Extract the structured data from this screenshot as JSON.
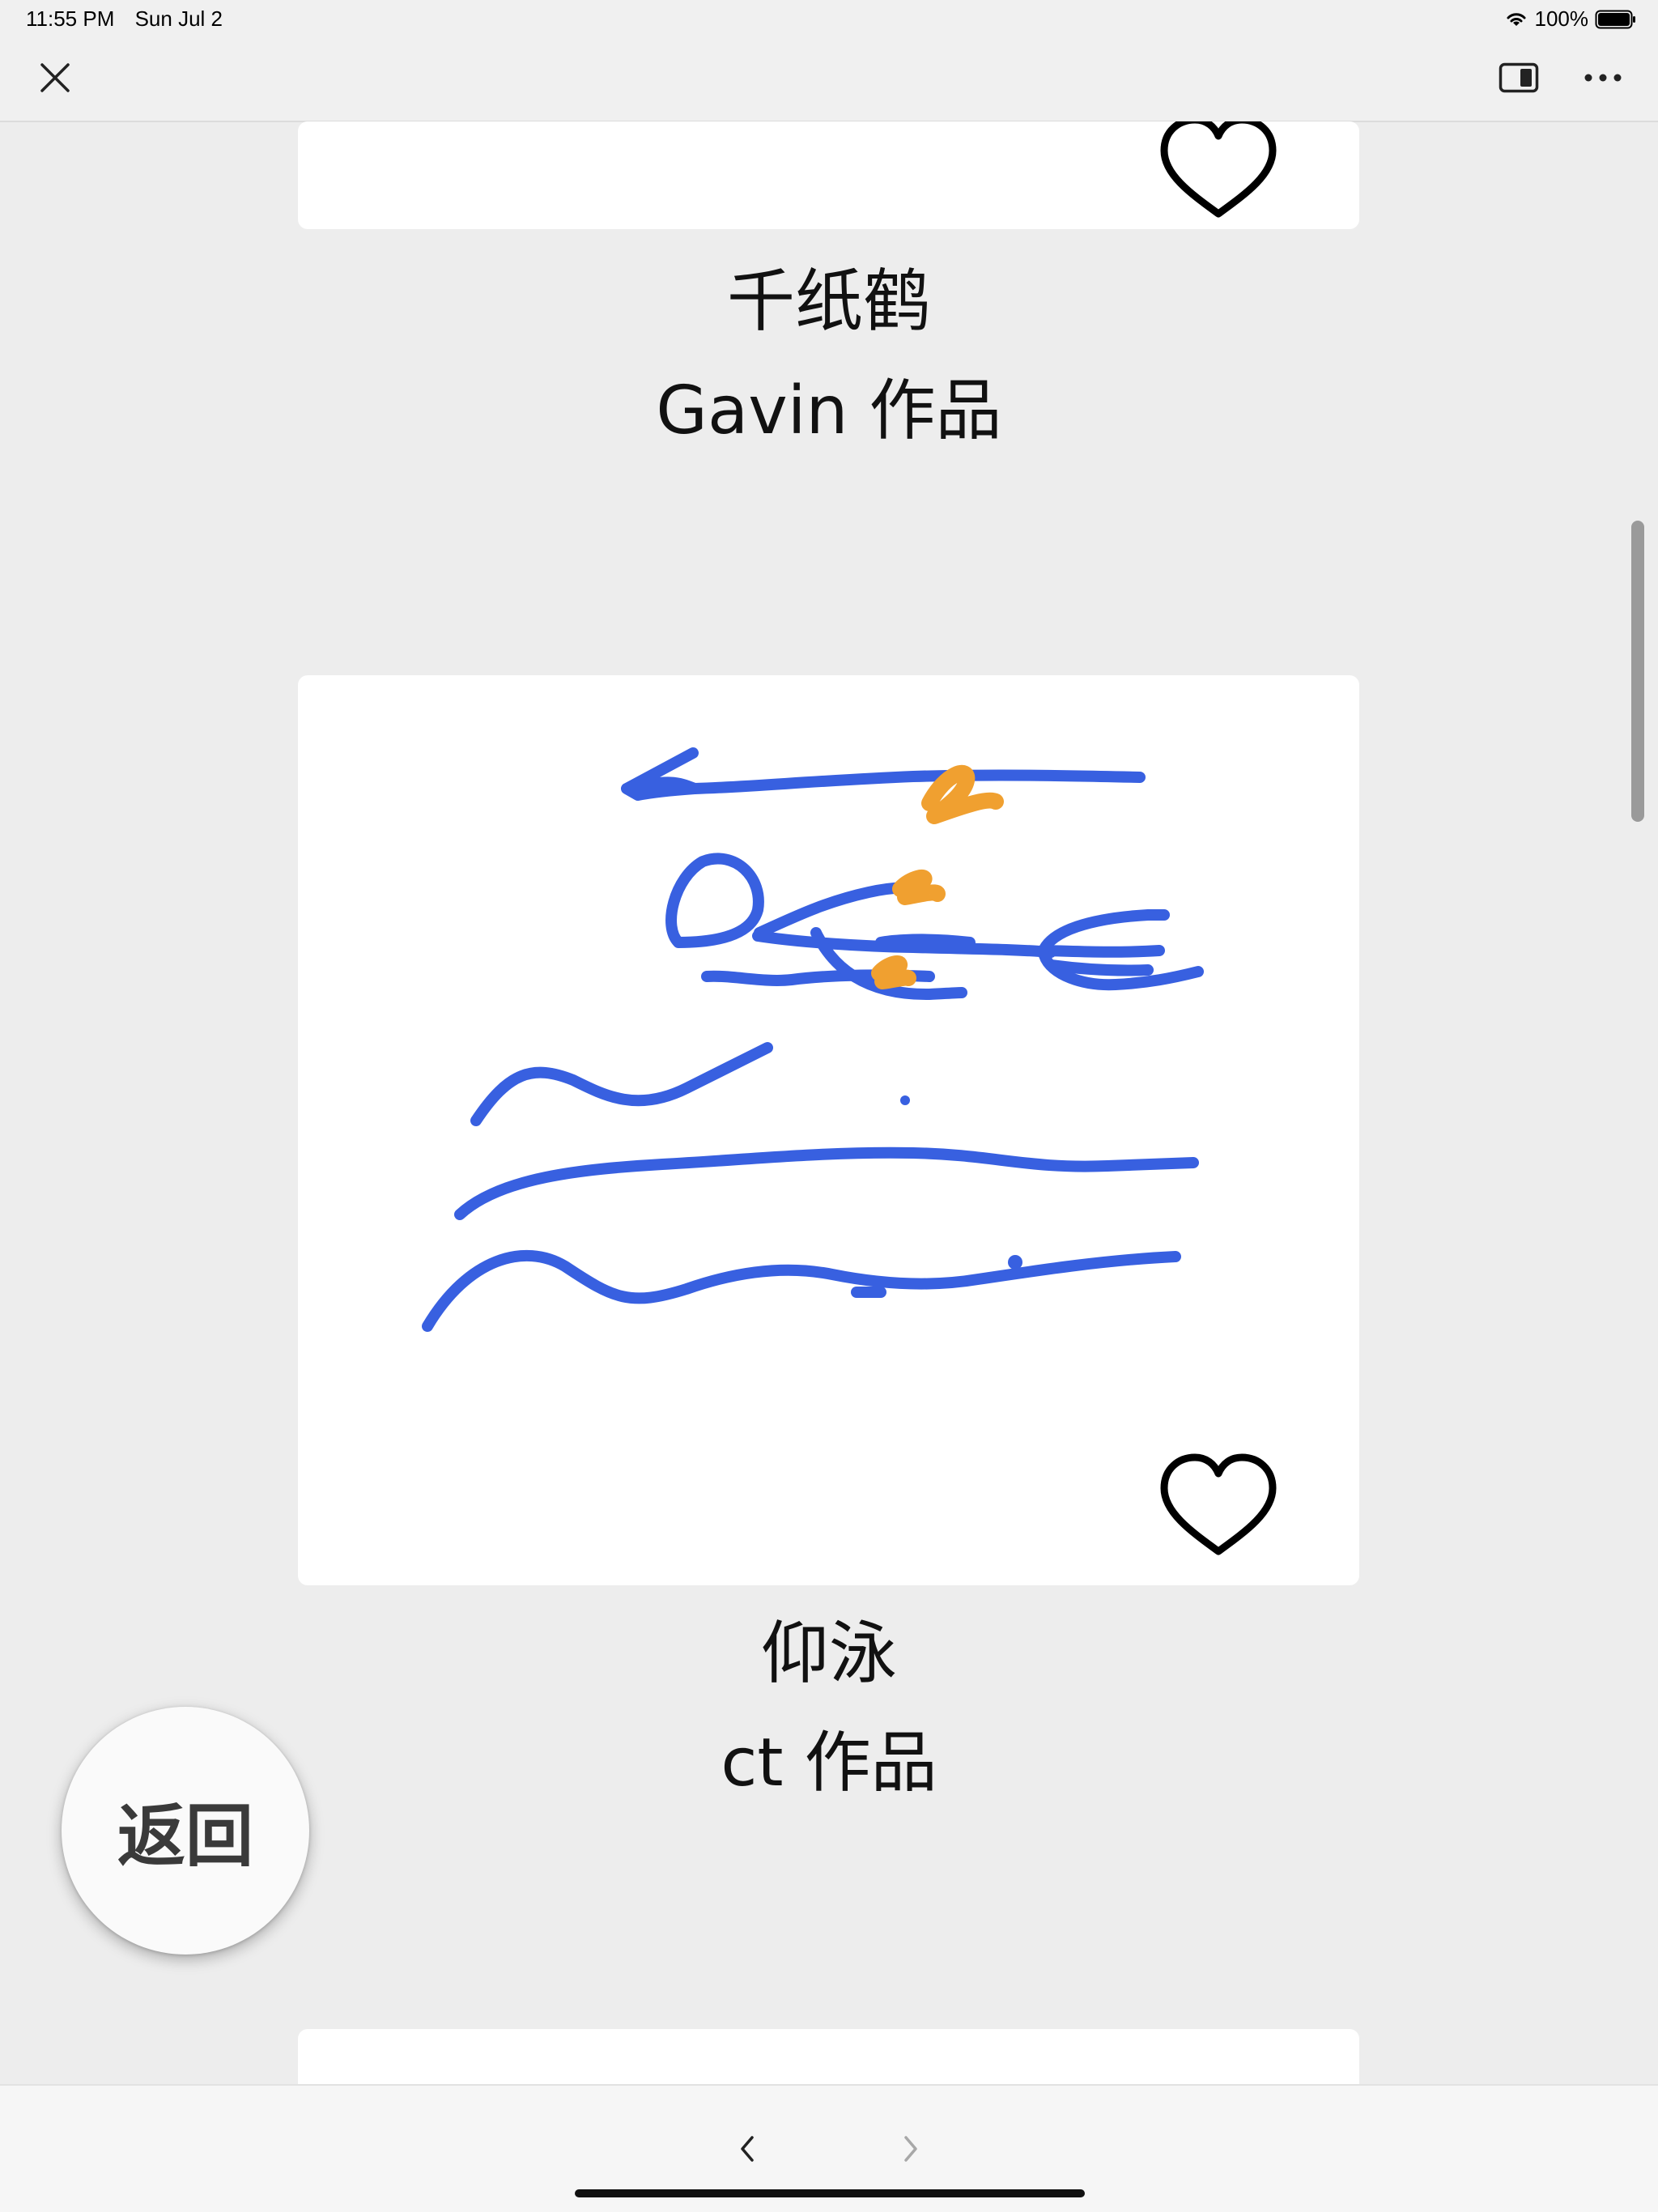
{
  "status_bar": {
    "time": "11:55 PM",
    "date": "Sun Jul 2",
    "battery": "100%",
    "icons": [
      "wifi-icon",
      "battery-icon"
    ]
  },
  "top_bar": {
    "icons": [
      "close-icon",
      "sidebar-toggle-icon",
      "more-icon"
    ]
  },
  "items": [
    {
      "title": "千纸鹤",
      "author": "Gavin 作品",
      "icon": "heart-icon"
    },
    {
      "title": "仰泳",
      "author": "ct 作品",
      "icon": "heart-icon",
      "drawing_colors": {
        "stroke_main": "#3860e0",
        "stroke_accent": "#f0a030"
      }
    }
  ],
  "fab": {
    "label": "返回"
  },
  "bottom_bar": {
    "icons": [
      "chevron-left-icon",
      "chevron-right-icon"
    ]
  }
}
